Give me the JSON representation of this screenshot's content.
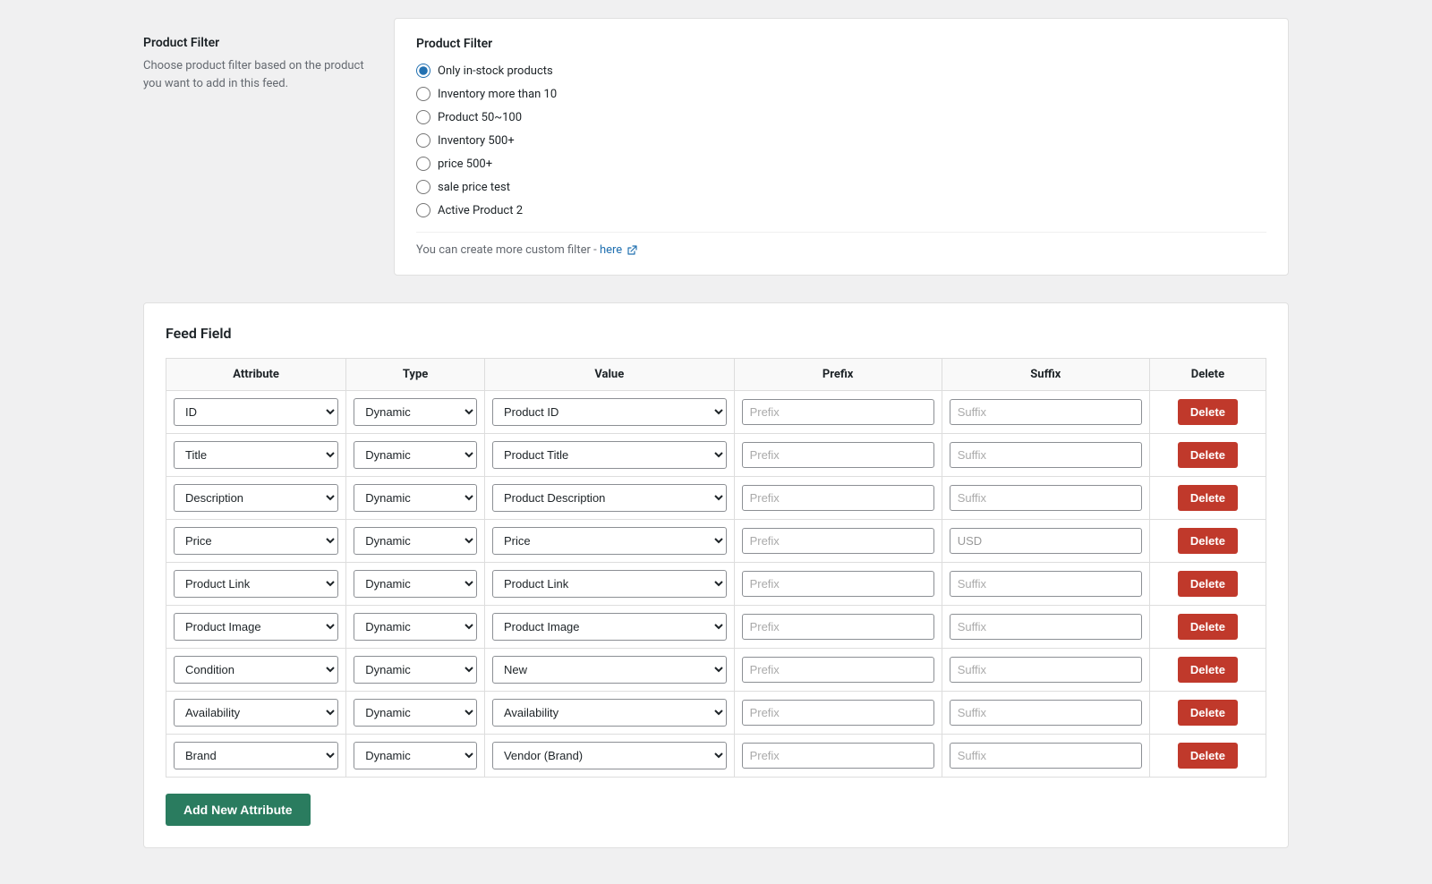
{
  "productFilter": {
    "sectionTitle": "Product Filter",
    "sectionDescription": "Choose product filter based on the product you want to add in this feed.",
    "cardTitle": "Product Filter",
    "options": [
      {
        "id": "opt1",
        "label": "Only in-stock products",
        "checked": true
      },
      {
        "id": "opt2",
        "label": "Inventory more than 10",
        "checked": false
      },
      {
        "id": "opt3",
        "label": "Product 50~100",
        "checked": false
      },
      {
        "id": "opt4",
        "label": "Inventory 500+",
        "checked": false
      },
      {
        "id": "opt5",
        "label": "price 500+",
        "checked": false
      },
      {
        "id": "opt6",
        "label": "sale price test",
        "checked": false
      },
      {
        "id": "opt7",
        "label": "Active Product 2",
        "checked": false
      }
    ],
    "customFilterNote": "You can create more custom filter -",
    "customFilterLinkText": "here",
    "customFilterLinkHref": "#"
  },
  "feedField": {
    "sectionTitle": "Feed Field",
    "columns": [
      "Attribute",
      "Type",
      "Value",
      "Prefix",
      "Suffix",
      "Delete"
    ],
    "rows": [
      {
        "attribute": "ID",
        "type": "Dynamic",
        "value": "Product ID",
        "prefix": "",
        "prefixPlaceholder": "Prefix",
        "suffix": "",
        "suffixPlaceholder": "Suffix"
      },
      {
        "attribute": "Title",
        "type": "Dynamic",
        "value": "Product Title",
        "prefix": "",
        "prefixPlaceholder": "Prefix",
        "suffix": "",
        "suffixPlaceholder": "Suffix"
      },
      {
        "attribute": "Description",
        "type": "Dynamic",
        "value": "Product Description",
        "prefix": "",
        "prefixPlaceholder": "Prefix",
        "suffix": "",
        "suffixPlaceholder": "Suffix"
      },
      {
        "attribute": "Price",
        "type": "Dynamic",
        "value": "Price",
        "prefix": "",
        "prefixPlaceholder": "Prefix",
        "suffix": "USD",
        "suffixPlaceholder": "Suffix"
      },
      {
        "attribute": "Product Link",
        "type": "Dynamic",
        "value": "Product Link",
        "prefix": "",
        "prefixPlaceholder": "Prefix",
        "suffix": "",
        "suffixPlaceholder": "Suffix"
      },
      {
        "attribute": "Product Image",
        "type": "Dynamic",
        "value": "Product Image",
        "prefix": "",
        "prefixPlaceholder": "Prefix",
        "suffix": "",
        "suffixPlaceholder": "Suffix"
      },
      {
        "attribute": "Condition",
        "type": "Dynamic",
        "value": "New",
        "prefix": "",
        "prefixPlaceholder": "Prefix",
        "suffix": "",
        "suffixPlaceholder": "Suffix"
      },
      {
        "attribute": "Availability",
        "type": "Dynamic",
        "value": "Availability",
        "prefix": "",
        "prefixPlaceholder": "Prefix",
        "suffix": "",
        "suffixPlaceholder": "Suffix"
      },
      {
        "attribute": "Brand",
        "type": "Dynamic",
        "value": "Vendor (Brand)",
        "prefix": "",
        "prefixPlaceholder": "Prefix",
        "suffix": "",
        "suffixPlaceholder": "Suffix"
      }
    ],
    "deleteButtonLabel": "Delete",
    "addButtonLabel": "Add New Attribute"
  }
}
